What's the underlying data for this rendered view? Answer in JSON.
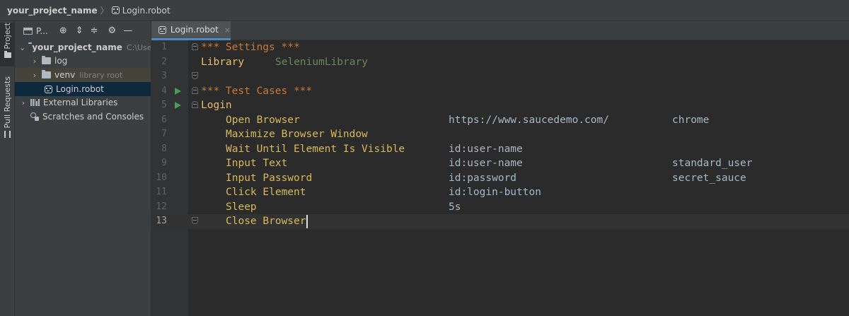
{
  "breadcrumb": {
    "project": "your_project_name",
    "file": "Login.robot"
  },
  "toolstrip": {
    "project_label": "Project",
    "pull_requests_label": "Pull Requests"
  },
  "project_panel": {
    "title": "P...",
    "tree": [
      {
        "label": "your_project_name",
        "hint": "C:\\Users",
        "expanded": true
      },
      {
        "label": "log",
        "hint": ""
      },
      {
        "label": "venv",
        "hint": "library root"
      },
      {
        "label": "Login.robot",
        "hint": "",
        "selected": true
      },
      {
        "label": "External Libraries",
        "hint": ""
      },
      {
        "label": "Scratches and Consoles",
        "hint": ""
      }
    ]
  },
  "editor": {
    "tab_label": "Login.robot",
    "tab_close": "×",
    "line_numbers": [
      "1",
      "2",
      "3",
      "4",
      "5",
      "6",
      "7",
      "8",
      "9",
      "10",
      "11",
      "12",
      "13"
    ],
    "lines": {
      "l1": "*** Settings ***",
      "l2_setting": "Library",
      "l2_value": "SeleniumLibrary",
      "l4": "*** Test Cases ***",
      "l5": "Login",
      "l6_kw": "Open Browser",
      "l6_arg1": "https://www.saucedemo.com/",
      "l6_arg2": "chrome",
      "l7_kw": "Maximize Browser Window",
      "l8_kw": "Wait Until Element Is Visible",
      "l8_arg1": "id:user-name",
      "l9_kw": "Input Text",
      "l9_arg1": "id:user-name",
      "l9_arg2": "standard_user",
      "l10_kw": "Input Password",
      "l10_arg1": "id:password",
      "l10_arg2": "secret_sauce",
      "l11_kw": "Click Element",
      "l11_arg1": "id:login-button",
      "l12_kw": "Sleep",
      "l12_arg1": "5s",
      "l13_kw": "Close Browser"
    },
    "current_line": 13
  },
  "colors": {
    "section": "#cc7832",
    "setting": "#e8bf6a",
    "library": "#6a8759",
    "keyword": "#d7b95a",
    "argument": "#a9b7c6",
    "selection": "#0d293e",
    "accent": "#4a88c7",
    "run": "#499c54"
  }
}
